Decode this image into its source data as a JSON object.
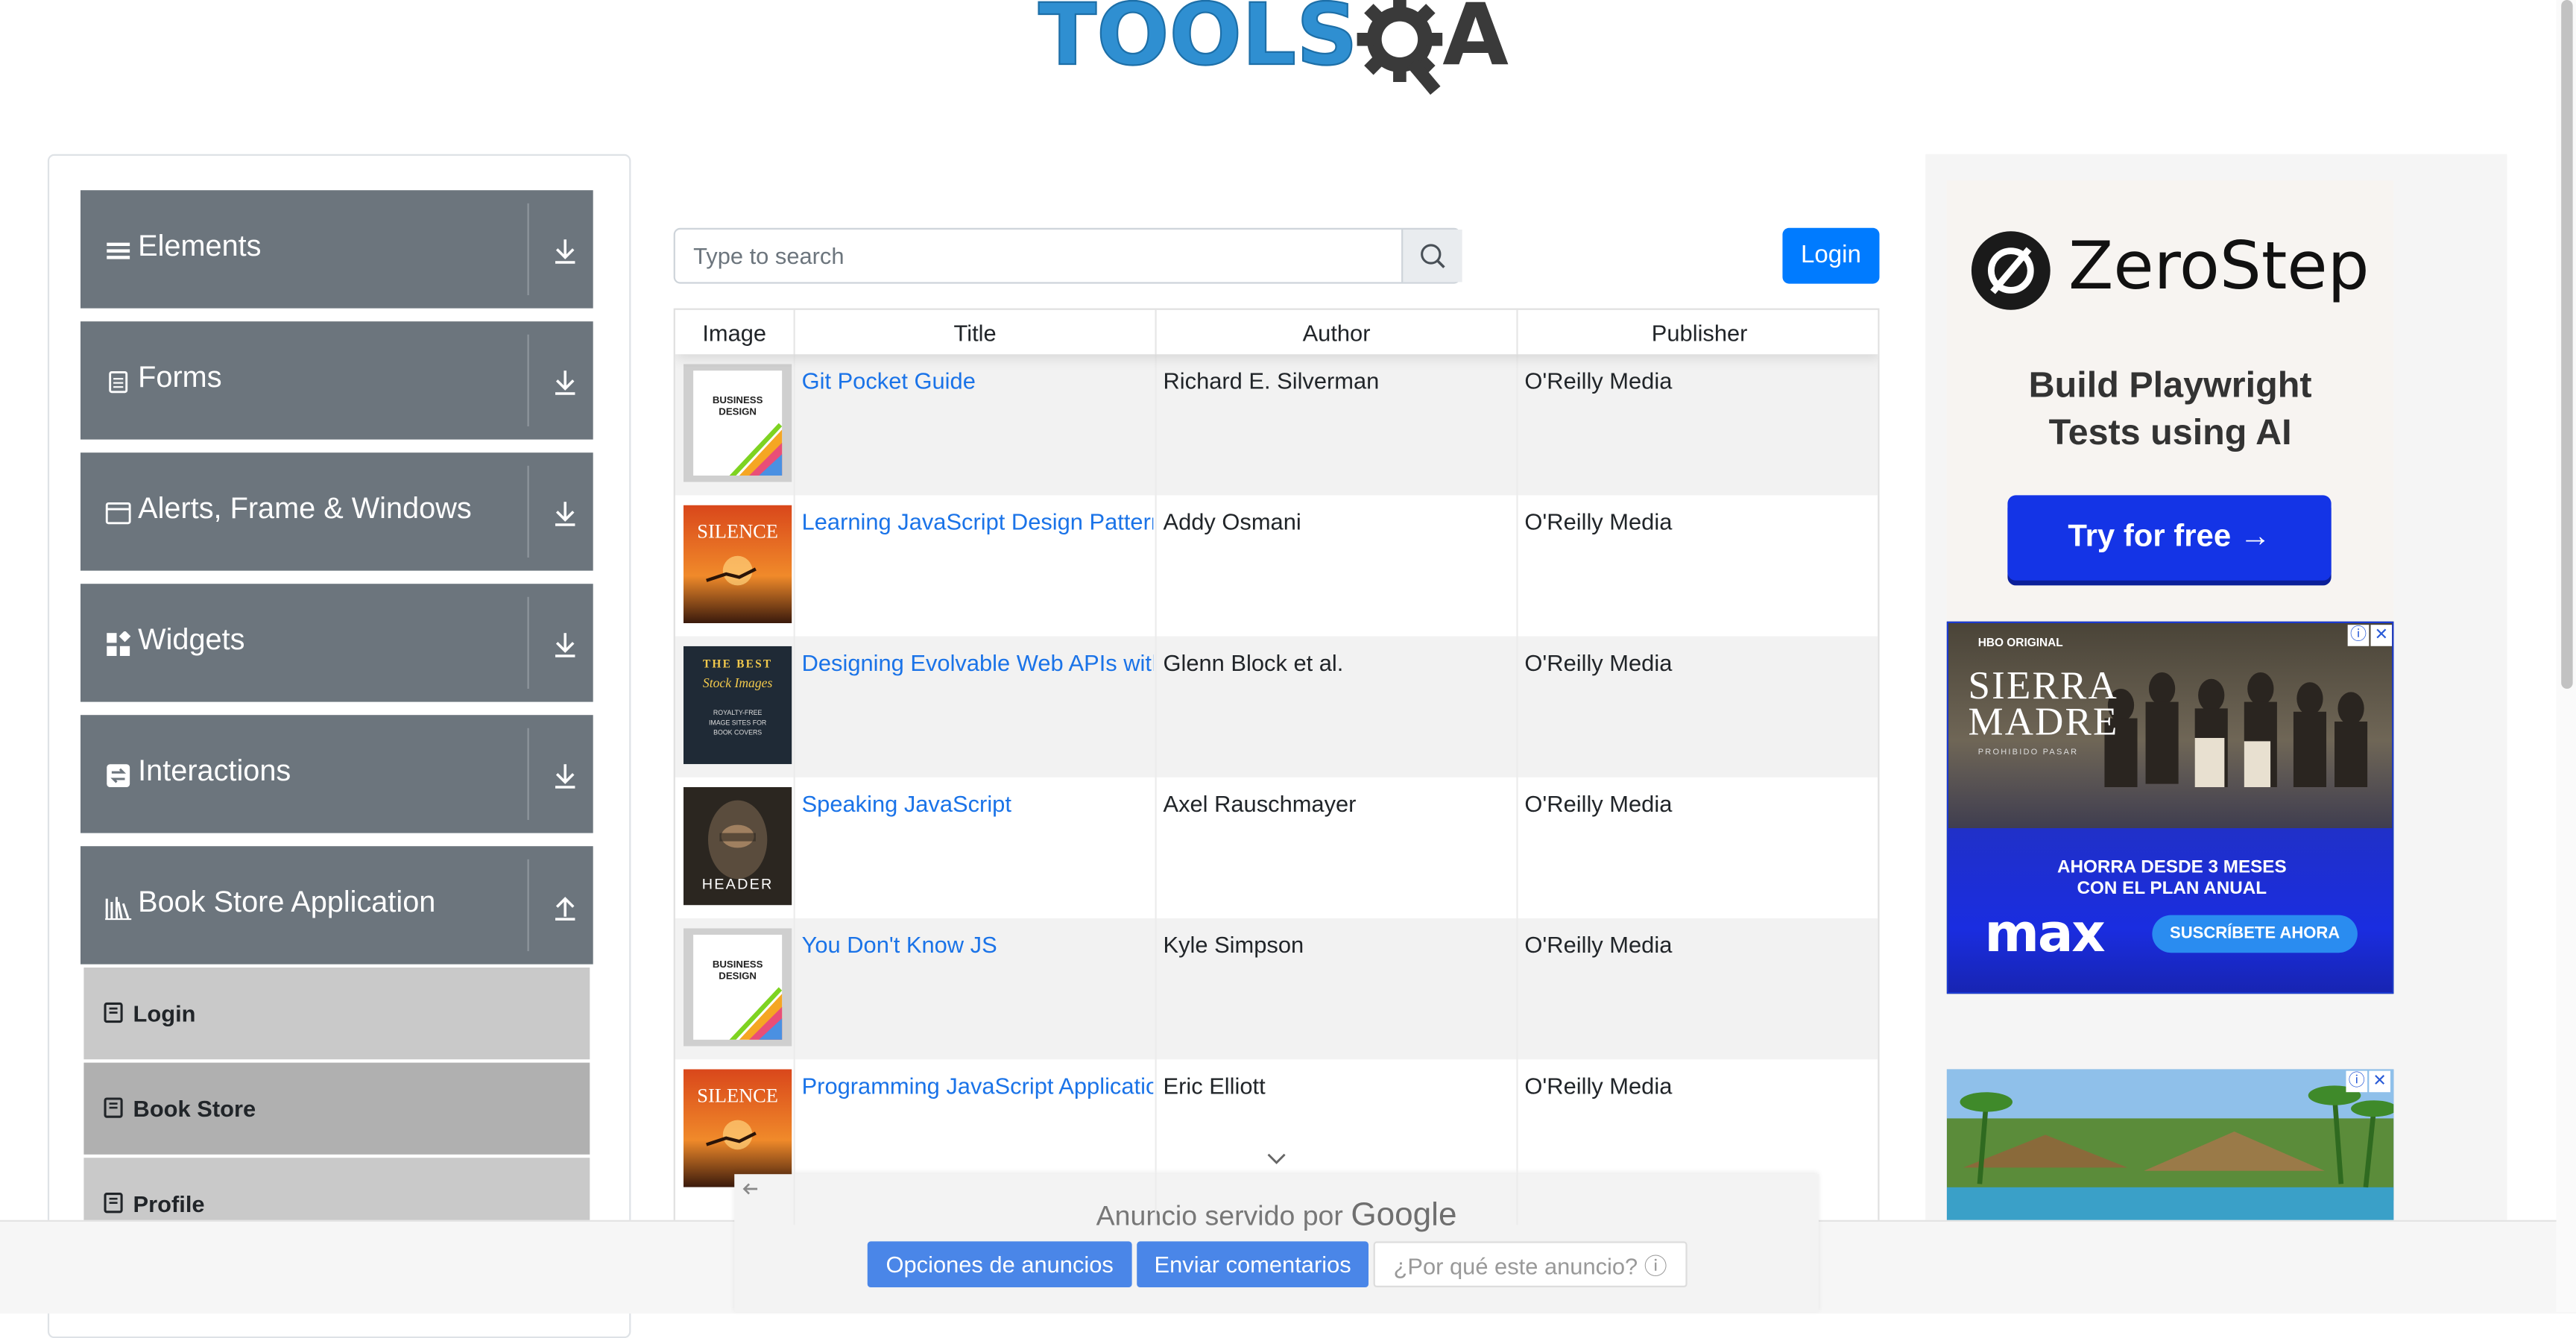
{
  "header": {
    "logo_text": "TOOLS",
    "logo_tail": "A"
  },
  "sidebar": {
    "groups": [
      {
        "label": "Elements",
        "icon": "hamburger-icon"
      },
      {
        "label": "Forms",
        "icon": "document-icon"
      },
      {
        "label": "Alerts, Frame & Windows",
        "icon": "window-icon"
      },
      {
        "label": "Widgets",
        "icon": "widgets-icon"
      },
      {
        "label": "Interactions",
        "icon": "interactions-icon"
      },
      {
        "label": "Book Store Application",
        "icon": "books-icon",
        "expanded": true
      }
    ],
    "items": [
      {
        "label": "Login"
      },
      {
        "label": "Book Store",
        "active": true
      },
      {
        "label": "Profile"
      }
    ]
  },
  "search": {
    "placeholder": "Type to search",
    "value": ""
  },
  "login_button": "Login",
  "table": {
    "columns": [
      "Image",
      "Title",
      "Author",
      "Publisher"
    ],
    "rows": [
      {
        "title": "Git Pocket Guide",
        "author": "Richard E. Silverman",
        "publisher": "O'Reilly Media",
        "cover": "business-design"
      },
      {
        "title": "Learning JavaScript Design Patterns",
        "author": "Addy Osmani",
        "publisher": "O'Reilly Media",
        "cover": "silence"
      },
      {
        "title": "Designing Evolvable Web APIs with ASP.NET",
        "author": "Glenn Block et al.",
        "publisher": "O'Reilly Media",
        "cover": "best-stock"
      },
      {
        "title": "Speaking JavaScript",
        "author": "Axel Rauschmayer",
        "publisher": "O'Reilly Media",
        "cover": "header"
      },
      {
        "title": "You Don't Know JS",
        "author": "Kyle Simpson",
        "publisher": "O'Reilly Media",
        "cover": "business-design"
      },
      {
        "title": "Programming JavaScript Applications",
        "author": "Eric Elliott",
        "publisher": "O'Reilly Media",
        "cover": "silence"
      }
    ]
  },
  "covers": {
    "business_design": {
      "line1": "BUSINESS",
      "line2": "DESIGN"
    },
    "silence": {
      "word": "SILENCE"
    },
    "best_stock": {
      "line1": "THE BEST",
      "line2": "Stock Images",
      "line3": "ROYALTY-FREE",
      "line4": "IMAGE SITES FOR",
      "line5": "BOOK COVERS"
    },
    "header": {
      "word": "HEADER"
    }
  },
  "ads": {
    "zerostep": {
      "name": "ZeroStep",
      "tagline_1": "Build Playwright",
      "tagline_2": "Tests using AI",
      "cta": "Try for free →"
    },
    "sierra": {
      "hbo": "HBO ORIGINAL",
      "title_1": "SIERRA",
      "title_2": "MADRE",
      "sub": "PROHIBIDO PASAR",
      "line1": "AHORRA DESDE 3 MESES",
      "line2": "CON EL PLAN ANUAL",
      "brand": "max",
      "cta": "SUSCRÍBETE AHORA"
    },
    "google_bar": {
      "served_prefix": "Anuncio servido por",
      "served_brand": "Google",
      "btn_options": "Opciones de anuncios",
      "btn_feedback": "Enviar comentarios",
      "btn_why": "¿Por qué este anuncio? ⓘ"
    }
  },
  "colors": {
    "sidebar_group": "#6c757d",
    "primary": "#007bff",
    "link": "#1a73e8"
  }
}
